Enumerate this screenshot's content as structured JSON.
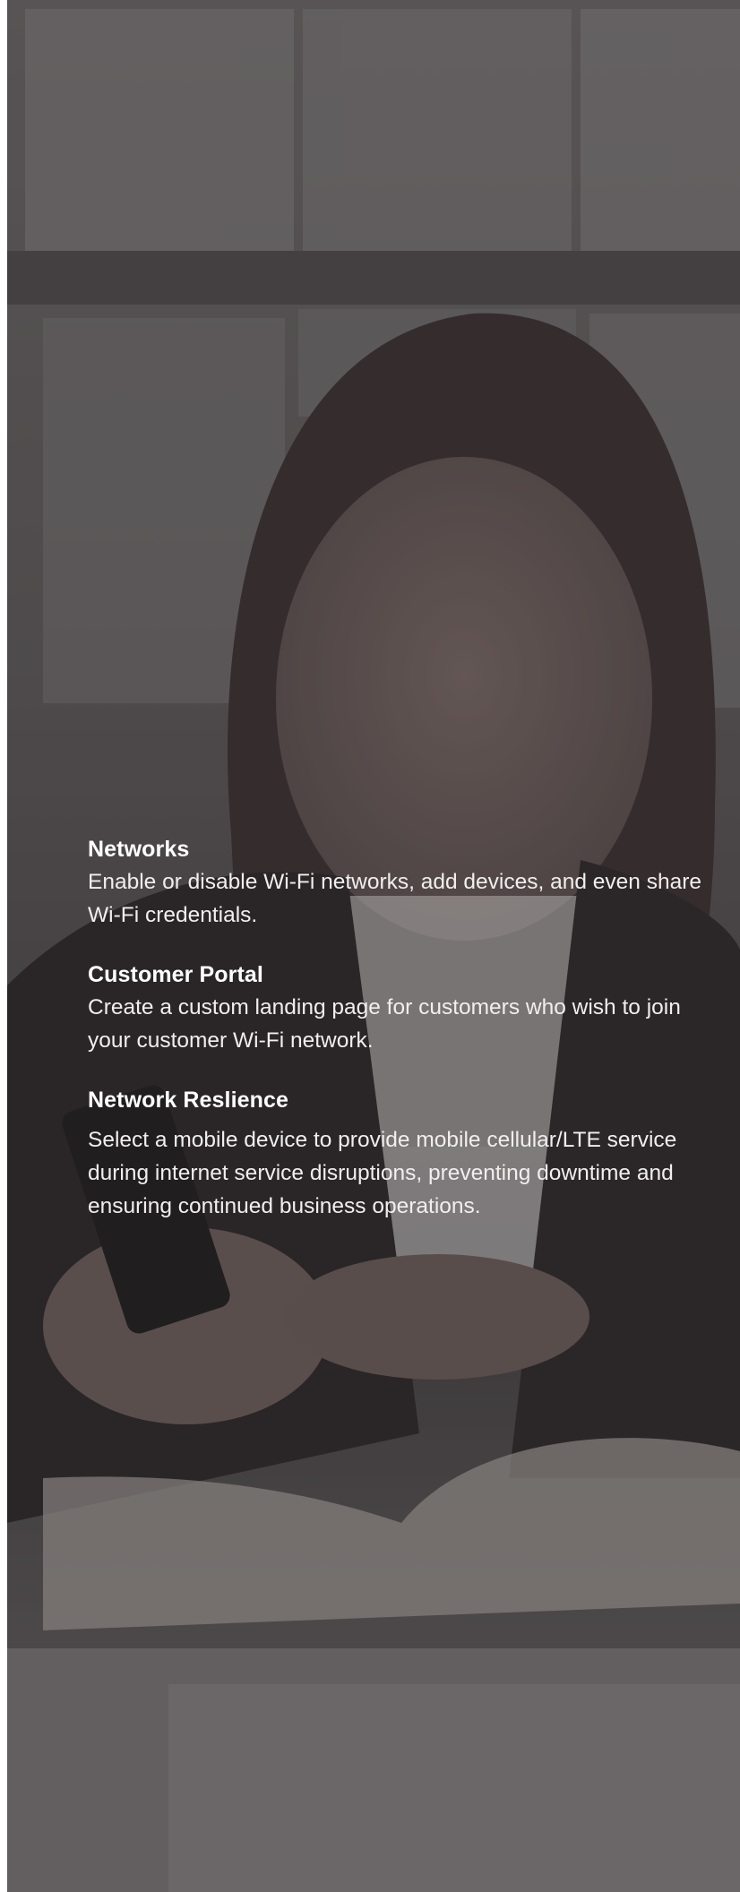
{
  "features": [
    {
      "title": "Networks",
      "description": "Enable or disable Wi-Fi networks, add devices, and even share Wi-Fi credentials."
    },
    {
      "title": "Customer Portal",
      "description": "Create a custom landing page for customers who wish to join your customer Wi-Fi network."
    },
    {
      "title": "Network Reslience",
      "description": "Select a mobile device to provide mobile cellular/LTE service during internet service disruptions, preventing downtime and ensuring continued business operations."
    }
  ],
  "colors": {
    "overlay": "#4a4647",
    "text": "#ffffff"
  }
}
